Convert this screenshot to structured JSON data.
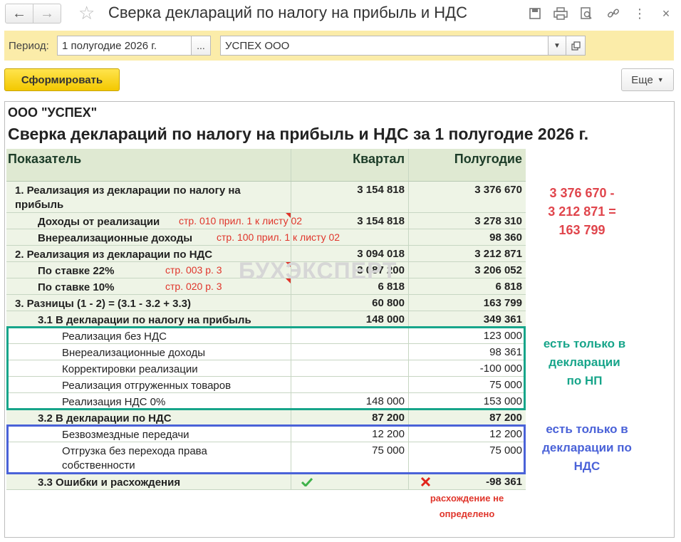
{
  "window": {
    "title": "Сверка деклараций по налогу на прибыль и НДС",
    "back_icon": "arrow-left-icon",
    "forward_icon": "arrow-right-icon"
  },
  "filters": {
    "period_label": "Период:",
    "period_value": "1 полугодие 2026 г.",
    "period_select_label": "...",
    "org_value": "УСПЕХ ООО"
  },
  "toolbar": {
    "generate_label": "Сформировать",
    "more_label": "Еще"
  },
  "report": {
    "org": "ООО \"УСПЕХ\"",
    "title": "Сверка деклараций по налогу на прибыль и НДС за 1 полугодие 2026 г.",
    "watermark": "БУХЭКСПЕРТ",
    "columns": [
      "Показатель",
      "Квартал",
      "Полугодие"
    ],
    "rows": [
      {
        "label": "1. Реализация из декларации по налогу на прибыль",
        "q": "3 154 818",
        "h": "3 376 670"
      },
      {
        "label": "Доходы от реализации",
        "q": "3 154 818",
        "h": "3 278 310",
        "note": "стр. 010 прил. 1 к листу 02"
      },
      {
        "label": "Внереализационные доходы",
        "q": "",
        "h": "98 360",
        "note": "стр. 100 прил. 1 к листу 02"
      },
      {
        "label": "2. Реализация из декларации по НДС",
        "q": "3 094 018",
        "h": "3 212 871"
      },
      {
        "label": "По ставке 22%",
        "q": "3 087 200",
        "h": "3 206 052",
        "note": "стр. 003 р. 3"
      },
      {
        "label": "По ставке 10%",
        "q": "6 818",
        "h": "6 818",
        "note": "стр. 020 р. 3"
      },
      {
        "label": "3. Разницы (1 - 2) = (3.1 - 3.2 + 3.3)",
        "q": "60 800",
        "h": "163 799"
      },
      {
        "label": "3.1 В декларации по налогу на прибыль",
        "q": "148 000",
        "h": "349 361"
      },
      {
        "label": "Реализация без НДС",
        "q": "",
        "h": "123 000"
      },
      {
        "label": "Внереализационные доходы",
        "q": "",
        "h": "98 361"
      },
      {
        "label": "Корректировки реализации",
        "q": "",
        "h": "-100 000"
      },
      {
        "label": "Реализация отгруженных товаров",
        "q": "",
        "h": "75 000"
      },
      {
        "label": "Реализация НДС 0%",
        "q": "148 000",
        "h": "153 000"
      },
      {
        "label": "3.2 В декларации по НДС",
        "q": "87 200",
        "h": "87 200"
      },
      {
        "label": "Безвозмездные передачи",
        "q": "12 200",
        "h": "12 200"
      },
      {
        "label": "Отгрузка без перехода права собственности",
        "q": "75 000",
        "h": "75 000"
      },
      {
        "label": "3.3 Ошибки и расхождения",
        "q": "",
        "h": "-98 361"
      }
    ]
  },
  "annotations": {
    "calc": [
      "3 376 670 -",
      "3 212 871 =",
      "163 799"
    ],
    "only_np": [
      "есть только в",
      "декларации",
      "по НП"
    ],
    "only_nds": [
      "есть только в",
      "декларации по",
      "НДС"
    ],
    "not_defined": [
      "расхождение не",
      "определено"
    ]
  },
  "colors": {
    "accent_yellow": "#f3c800",
    "panel": "#fbeca9",
    "green_box": "#17a58a",
    "blue_box": "#4a62d8",
    "red_note": "#e0352b"
  }
}
